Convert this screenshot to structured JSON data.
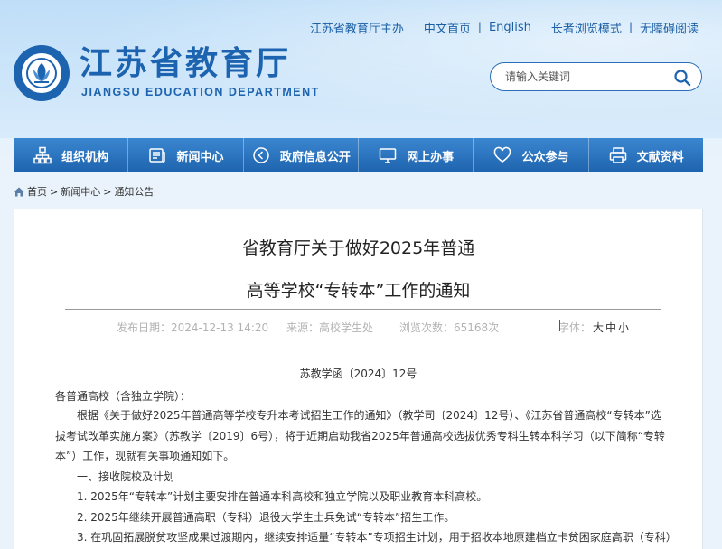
{
  "top_links": {
    "host": "江苏省教育厅主办",
    "chinese": "中文首页",
    "english": "English",
    "elderly": "长者浏览模式",
    "accessible": "无障碍阅读"
  },
  "logo": {
    "title": "江苏省教育厅",
    "subtitle": "JIANGSU EDUCATION DEPARTMENT"
  },
  "search": {
    "placeholder": "请输入关键词"
  },
  "nav": {
    "items": [
      {
        "label": "组织机构",
        "icon": "org-chart-icon"
      },
      {
        "label": "新闻中心",
        "icon": "newspaper-icon"
      },
      {
        "label": "政府信息公开",
        "icon": "info-disclosure-icon"
      },
      {
        "label": "网上办事",
        "icon": "monitor-icon"
      },
      {
        "label": "公众参与",
        "icon": "heart-icon"
      },
      {
        "label": "文献资料",
        "icon": "printer-icon"
      }
    ]
  },
  "breadcrumb": {
    "home": "首页",
    "news": "新闻中心",
    "notice": "通知公告"
  },
  "article": {
    "title_line1": "省教育厅关于做好2025年普通",
    "title_line2": "高等学校“专转本”工作的通知",
    "publish_time": "发布日期：2024-12-13 14:20",
    "source": "来源：高校学生处",
    "views": "浏览次数：65168次",
    "font_size_label": "字体：",
    "font_large": "大",
    "font_medium": "中",
    "font_small": "小",
    "doc_number": "苏教学函〔2024〕12号",
    "salutation": "各普通高校（含独立学院）：",
    "para1_line1": "根据《关于做好2025年普通高等学校专升本考试招生工作的通知》（教学司〔2024〕12号）、《江苏省普通高校“专转本”选",
    "para1_line2": "拔考试改革实施方案》（苏教学〔2019〕6号），将于近期启动我省2025年普通高校选拔优秀专科生转本科学习（以下简称“专转",
    "para1_line3": "本”）工作，现就有关事项通知如下。",
    "section1": "一、接收院校及计划",
    "item1": "1. 2025年“专转本”计划主要安排在普通本科高校和独立学院以及职业教育本科高校。",
    "item2": "2. 2025年继续开展普通高职（专科）退役大学生士兵免试“专转本”招生工作。",
    "item3": "3. 在巩固拓展脱贫攻坚成果过渡期内，继续安排适量“专转本”专项招生计划，用于招收本地原建档立卡贫困家庭高职（专科）"
  },
  "colors": {
    "brand_blue": "#1c63b0",
    "nav_top": "#3b86d0",
    "nav_bottom": "#1e63ae"
  }
}
